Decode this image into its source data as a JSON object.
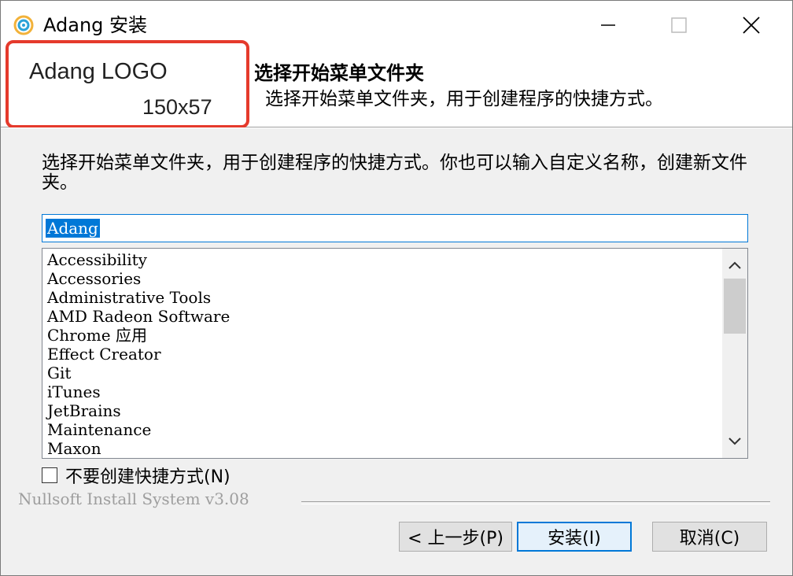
{
  "window": {
    "title": "Adang 安装"
  },
  "header": {
    "logo_title": "Adang LOGO",
    "logo_size": "150x57",
    "title": "选择开始菜单文件夹",
    "subtitle": "选择开始菜单文件夹，用于创建程序的快捷方式。"
  },
  "body": {
    "description": "选择开始菜单文件夹，用于创建程序的快捷方式。你也可以输入自定义名称，创建新文件夹。",
    "folder_value": "Adang",
    "list_items": [
      "Accessibility",
      "Accessories",
      "Administrative Tools",
      "AMD Radeon Software",
      "Chrome 应用",
      "Effect Creator",
      "Git",
      "iTunes",
      "JetBrains",
      "Maintenance",
      "Maxon"
    ],
    "checkbox_label": "不要创建快捷方式(N)",
    "checkbox_checked": false
  },
  "footer": {
    "brand": "Nullsoft Install System v3.08",
    "back_label": "< 上一步(P)",
    "install_label": "安装(I)",
    "cancel_label": "取消(C)"
  },
  "colors": {
    "accent": "#0078d7",
    "logo_border": "#e53a2c"
  }
}
